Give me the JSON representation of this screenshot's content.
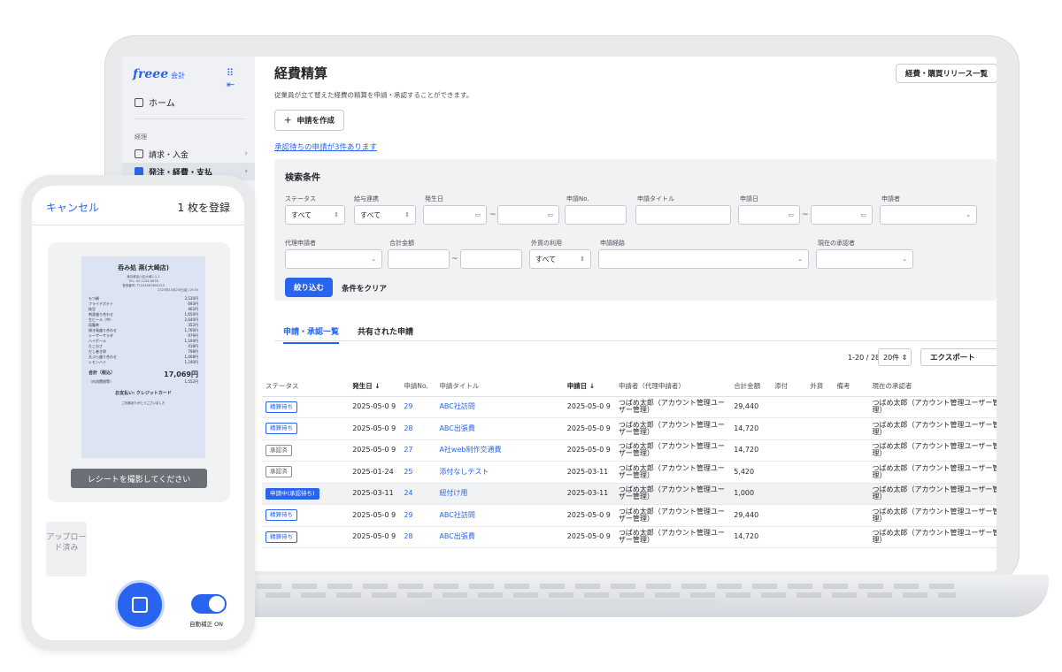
{
  "sidebar": {
    "logo": "freee",
    "logo_sub": "会計",
    "home": "ホーム",
    "section": "経理",
    "items": [
      {
        "label": "請求・入金"
      },
      {
        "label": "発注・経費・支払"
      }
    ]
  },
  "header": {
    "title": "経費精算",
    "top_right_button": "経費・購買リリース一覧",
    "subtitle": "従業員が立て替えた経費の精算を申請・承認することができます。",
    "create_button": "申請を作成",
    "pending_link": "承認待ちの申請が3件あります"
  },
  "search": {
    "title": "検索条件",
    "labels": {
      "status": "ステータス",
      "payroll": "給与連携",
      "issue_date": "発生日",
      "request_no": "申請No.",
      "request_title": "申請タイトル",
      "request_date": "申請日",
      "applicant": "申請者",
      "proxy": "代理申請者",
      "total": "合計金額",
      "foreign": "外貨の利用",
      "route": "申請経路",
      "approver": "現在の承認者"
    },
    "values": {
      "status": "すべて",
      "payroll": "すべて",
      "foreign": "すべて"
    },
    "tilde": "~",
    "filter_button": "絞り込む",
    "clear_button": "条件をクリア"
  },
  "tabs": [
    {
      "label": "申請・承認一覧"
    },
    {
      "label": "共有された申請"
    }
  ],
  "pager": {
    "range": "1-20 / 28",
    "per_page": "20件",
    "export": "エクスポート"
  },
  "table": {
    "headers": {
      "status": "ステータス",
      "issue_date": "発生日 ↓",
      "no": "申請No.",
      "title": "申請タイトル",
      "request_date": "申請日 ↓",
      "applicant": "申請者（代理申請者）",
      "amount": "合計金額",
      "attach": "添付",
      "foreign": "外貨",
      "note": "備考",
      "approver": "現在の承認者"
    },
    "rows": [
      {
        "status": "精算待ち",
        "date": "2025-05-0 9",
        "no": "29",
        "title": "ABC社訪問",
        "req_date": "2025-05-0 9",
        "applicant": "つばめ太郎（アカウント管理ユーザー管理）",
        "amount": "29,440",
        "approver": "つばめ太郎（アカウント管理ユーザー管理）"
      },
      {
        "status": "精算待ち",
        "date": "2025-05-0 9",
        "no": "28",
        "title": "ABC出張費",
        "req_date": "2025-05-0 9",
        "applicant": "つばめ太郎（アカウント管理ユーザー管理）",
        "amount": "14,720",
        "approver": "つばめ太郎（アカウント管理ユーザー管理）"
      },
      {
        "status": "承認済",
        "date": "2025-05-0 9",
        "no": "27",
        "title": "A社web制作交通費",
        "req_date": "2025-05-0 9",
        "applicant": "つばめ太郎（アカウント管理ユーザー管理）",
        "amount": "14,720",
        "approver": "つばめ太郎（アカウント管理ユーザー管理）"
      },
      {
        "status": "承認済",
        "date": "2025-01-24",
        "no": "25",
        "title": "添付なしテスト",
        "req_date": "2025-03-11",
        "applicant": "つばめ太郎（アカウント管理ユーザー管理）",
        "amount": "5,420",
        "approver": "つばめ太郎（アカウント管理ユーザー管理）"
      },
      {
        "status": "申請中(承認待ち)",
        "date": "2025-03-11",
        "no": "24",
        "title": "紐付け用",
        "req_date": "2025-03-11",
        "applicant": "つばめ太郎（アカウント管理ユーザー管理）",
        "amount": "1,000",
        "approver": "つばめ太郎（アカウント管理ユーザー管理）"
      },
      {
        "status": "精算待ち",
        "date": "2025-05-0 9",
        "no": "29",
        "title": "ABC社訪問",
        "req_date": "2025-05-0 9",
        "applicant": "つばめ太郎（アカウント管理ユーザー管理）",
        "amount": "29,440",
        "approver": "つばめ太郎（アカウント管理ユーザー管理）"
      },
      {
        "status": "精算待ち",
        "date": "2025-05-0 9",
        "no": "28",
        "title": "ABC出張費",
        "req_date": "2025-05-0 9",
        "applicant": "つばめ太郎（アカウント管理ユーザー管理）",
        "amount": "14,720",
        "approver": "つばめ太郎（アカウント管理ユーザー管理）"
      }
    ]
  },
  "phone": {
    "cancel": "キャンセル",
    "register": "1 枚を登録",
    "receipt": {
      "shop": "呑み処 燕(大崎店)",
      "address": "東京都品川区大崎1-1-1",
      "tel": "TEL: 03-1234-5678",
      "reg": "登録番号: T1234567890123",
      "date": "2023年10月20日(金) 19:33",
      "items": [
        {
          "name": "もつ鍋",
          "price": "3,530円"
        },
        {
          "name": "フライドポテト",
          "price": "693円"
        },
        {
          "name": "枝豆",
          "price": "462円"
        },
        {
          "name": "刺身盛り合わせ",
          "price": "1,650円"
        },
        {
          "name": "生ビール（中）",
          "price": "2,640円"
        },
        {
          "name": "烏龍茶",
          "price": "352円"
        },
        {
          "name": "焼き鳥盛り合わせ",
          "price": "1,760円"
        },
        {
          "name": "シーザーサラダ",
          "price": "979円"
        },
        {
          "name": "ハイボール",
          "price": "1,100円"
        },
        {
          "name": "たこわさ",
          "price": "418円"
        },
        {
          "name": "だし巻き卵",
          "price": "798円"
        },
        {
          "name": "天ぷら盛り合わせ",
          "price": "1,408円"
        },
        {
          "name": "レモンハイ",
          "price": "1,240円"
        }
      ],
      "total_label": "合計（税込）",
      "total": "17,069円",
      "tax_label": "（内消費税等）",
      "tax": "1,552円",
      "payment": "お支払い: クレジットカード",
      "thanks": "ご利用ありがとうございました"
    },
    "hint": "レシートを撮影してください",
    "uploaded": "アップロード済み",
    "toggle_label": "自動補正 ON"
  },
  "colors": {
    "accent": "#2864f0",
    "sidebar_bg": "#eff1f4",
    "panel_bg": "#f1f2f4"
  }
}
